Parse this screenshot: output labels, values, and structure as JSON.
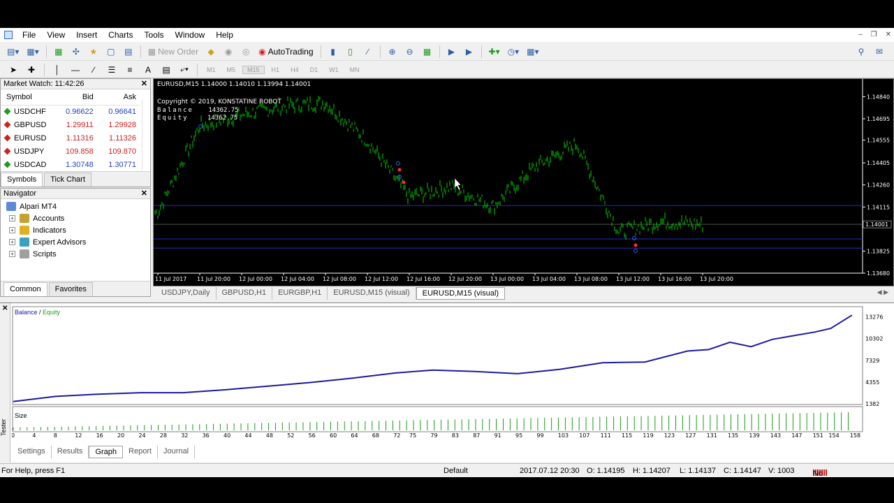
{
  "menu": [
    "File",
    "View",
    "Insert",
    "Charts",
    "Tools",
    "Window",
    "Help"
  ],
  "toolbar": {
    "new_order": "New Order",
    "autotrading": "AutoTrading"
  },
  "timeframes": [
    "M1",
    "M5",
    "M15",
    "H1",
    "H4",
    "D1",
    "W1",
    "MN"
  ],
  "market_watch": {
    "title": "Market Watch: 11:42:26",
    "headers": [
      "Symbol",
      "Bid",
      "Ask"
    ],
    "rows": [
      {
        "symbol": "USDCHF",
        "bid": "0.96622",
        "ask": "0.96641",
        "color": "#1a9a1a"
      },
      {
        "symbol": "GBPUSD",
        "bid": "1.29911",
        "ask": "1.29928",
        "color": "#d02020"
      },
      {
        "symbol": "EURUSD",
        "bid": "1.11316",
        "ask": "1.11326",
        "color": "#d02020"
      },
      {
        "symbol": "USDJPY",
        "bid": "109.858",
        "ask": "109.870",
        "color": "#d02020"
      },
      {
        "symbol": "USDCAD",
        "bid": "1.30748",
        "ask": "1.30771",
        "color": "#1a9a1a"
      }
    ],
    "tabs": [
      "Symbols",
      "Tick Chart"
    ]
  },
  "navigator": {
    "title": "Navigator",
    "items": [
      {
        "label": "Alpari MT4",
        "icon": "terminal-icon"
      },
      {
        "label": "Accounts",
        "icon": "accounts-icon"
      },
      {
        "label": "Indicators",
        "icon": "indicators-icon"
      },
      {
        "label": "Expert Advisors",
        "icon": "expert-advisors-icon"
      },
      {
        "label": "Scripts",
        "icon": "scripts-icon"
      }
    ],
    "tabs": [
      "Common",
      "Favorites"
    ]
  },
  "chart": {
    "info": "EURUSD,M15  1.14000 1.14010 1.13994 1.14001",
    "copyright": "Copyright © 2019, KONSTATINE ROBOT",
    "balance_label": "Balance",
    "balance_value": "14362.75",
    "equity_label": "Equity",
    "equity_value": "14362.75",
    "current_price": "1.14001",
    "price_labels": [
      "1.14840",
      "1.14695",
      "1.14555",
      "1.14405",
      "1.14260",
      "1.14115",
      "1.13825",
      "1.13680"
    ],
    "time_labels": [
      "11 Jul 2017",
      "11 Jul 20:00",
      "12 Jul 00:00",
      "12 Jul 04:00",
      "12 Jul 08:00",
      "12 Jul 12:00",
      "12 Jul 16:00",
      "12 Jul 20:00",
      "13 Jul 00:00",
      "13 Jul 04:00",
      "13 Jul 08:00",
      "13 Jul 12:00",
      "13 Jul 16:00",
      "13 Jul 20:00"
    ]
  },
  "chart_tabs": [
    "USDJPY,Daily",
    "GBPUSD,H1",
    "EURGBP,H1",
    "EURUSD,M15 (visual)",
    "EURUSD,M15 (visual)"
  ],
  "tester": {
    "side_label": "Tester",
    "legend_balance": "Balance",
    "legend_sep": " / ",
    "legend_equity": "Equity",
    "size_label": "Size",
    "y_labels": [
      "13276",
      "10302",
      "7329",
      "4355",
      "1382"
    ],
    "x_labels": [
      "0",
      "4",
      "8",
      "12",
      "16",
      "20",
      "24",
      "28",
      "32",
      "36",
      "40",
      "44",
      "48",
      "52",
      "56",
      "60",
      "64",
      "68",
      "72",
      "75",
      "79",
      "83",
      "87",
      "91",
      "95",
      "99",
      "103",
      "107",
      "111",
      "115",
      "119",
      "123",
      "127",
      "131",
      "135",
      "139",
      "143",
      "147",
      "151",
      "154",
      "158"
    ],
    "tabs": [
      "Settings",
      "Results",
      "Graph",
      "Report",
      "Journal"
    ],
    "colors": {
      "balance": "#1a1aa0",
      "equity": "#1a9a1a"
    }
  },
  "status": {
    "help": "For Help, press F1",
    "profile": "Default",
    "datetime": "2017.07.12 20:30",
    "open": "O: 1.14195",
    "high": "H: 1.14207",
    "low": "L: 1.14137",
    "close": "C: 1.14147",
    "volume": "V: 1003",
    "connection": "No connection"
  },
  "chart_data": [
    {
      "type": "line",
      "title": "EURUSD,M15",
      "x": [
        "11 Jul 2017",
        "11 Jul 20:00",
        "12 Jul 00:00",
        "12 Jul 04:00",
        "12 Jul 08:00",
        "12 Jul 12:00",
        "12 Jul 16:00",
        "12 Jul 20:00",
        "13 Jul 00:00",
        "13 Jul 04:00",
        "13 Jul 08:00",
        "13 Jul 12:00",
        "13 Jul 16:00",
        "13 Jul 20:00"
      ],
      "series": [
        {
          "values": [
            1.1408,
            1.1465,
            1.1472,
            1.1478,
            1.148,
            1.1455,
            1.1418,
            1.1425,
            1.1412,
            1.1438,
            1.1453,
            1.1395,
            1.1402,
            1.14
          ]
        }
      ],
      "ylim": [
        1.1368,
        1.1492
      ],
      "hlines": [
        1.14125,
        1.13905,
        1.13845
      ]
    },
    {
      "type": "line",
      "title": "Balance / Equity",
      "x": [
        0,
        8,
        16,
        24,
        32,
        40,
        48,
        56,
        64,
        72,
        79,
        87,
        95,
        103,
        111,
        119,
        127,
        131,
        135,
        139,
        143,
        147,
        151,
        154,
        158
      ],
      "series": [
        {
          "name": "Balance",
          "values": [
            1700,
            2400,
            2700,
            2900,
            2900,
            3300,
            3800,
            4300,
            4900,
            5600,
            6000,
            5800,
            5500,
            6100,
            7000,
            7100,
            8600,
            8800,
            9800,
            9200,
            10200,
            10700,
            11200,
            11700,
            13500
          ]
        },
        {
          "name": "Equity",
          "values": [
            1700,
            2400,
            2700,
            2900,
            2900,
            3300,
            3800,
            4300,
            4900,
            5600,
            6000,
            5800,
            5500,
            6100,
            7000,
            7100,
            8600,
            8800,
            9800,
            9200,
            10200,
            10700,
            11200,
            11700,
            13500
          ]
        }
      ],
      "ylim": [
        1382,
        14000
      ]
    }
  ]
}
